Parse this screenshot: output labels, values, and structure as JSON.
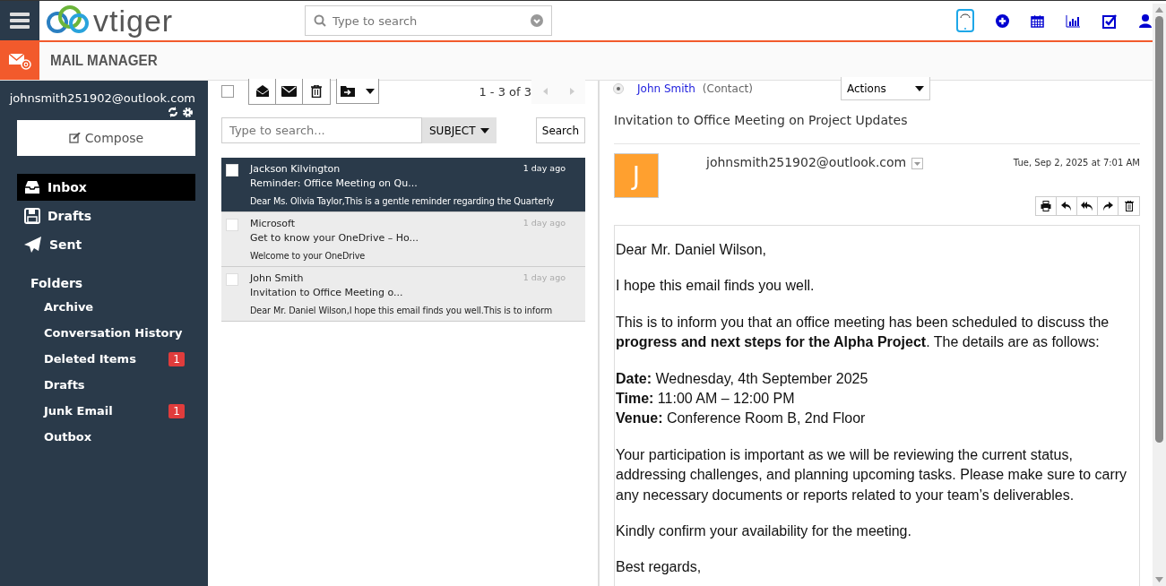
{
  "header": {
    "logo": "vtiger",
    "search": {
      "placeholder": "Type to search"
    }
  },
  "module_bar": {
    "title": "MAIL MANAGER"
  },
  "sidebar": {
    "account": "johnsmith251902@outlook.com",
    "compose": "Compose",
    "mailboxes": [
      {
        "kind": "inbox",
        "label": "Inbox",
        "selected": true
      },
      {
        "kind": "drafts",
        "label": "Drafts",
        "selected": false
      },
      {
        "kind": "sent",
        "label": "Sent",
        "selected": false
      }
    ],
    "folders_heading": "Folders",
    "folders": [
      {
        "label": "Archive"
      },
      {
        "label": "Conversation History"
      },
      {
        "label": "Deleted Items",
        "badge": "1"
      },
      {
        "label": "Drafts"
      },
      {
        "label": "Junk Email",
        "badge": "1"
      },
      {
        "label": "Outbox"
      }
    ]
  },
  "list": {
    "select_all": {
      "checked": false
    },
    "pagination": "1 - 3 of 3",
    "search": {
      "placeholder": "Type to search...",
      "field": "SUBJECT",
      "button": "Search"
    },
    "messages": [
      {
        "sender": "Jackson Kilvington",
        "time": "1 day ago",
        "subject": "Reminder: Office Meeting on Qu...",
        "preview": "Dear Ms. Olivia Taylor,This is a gentle reminder regarding the Quarterly",
        "selected": true,
        "checked": false
      },
      {
        "sender": "Microsoft",
        "time": "1 day ago",
        "subject": "Get to know your OneDrive – Ho...",
        "preview": "Welcome to your OneDrive",
        "selected": false,
        "checked": false
      },
      {
        "sender": "John Smith",
        "time": "1 day ago",
        "subject": "Invitation to Office Meeting o...",
        "preview": "Dear Mr. Daniel Wilson,I hope this email finds you well.This is to inform",
        "selected": false,
        "checked": false
      }
    ]
  },
  "reader": {
    "contact": {
      "name": "John Smith",
      "type": "(Contact)",
      "selected": true
    },
    "actions": "Actions",
    "subject": "Invitation to Office Meeting on Project Updates",
    "avatar_letter": "J",
    "from": "johnsmith251902@outlook.com",
    "date": "Tue, Sep 2, 2025 at 7:01 AM",
    "body": [
      "Dear Mr. Daniel Wilson,",
      "I hope this email finds you well.",
      "This is to inform you that an office meeting has been scheduled to discuss the **progress and next steps for the Alpha Project**. The details are as follows:",
      [
        "**Date:** Wednesday, 4th September 2025",
        "**Time:** 11:00 AM – 12:00 PM",
        "**Venue:** Conference Room B, 2nd Floor"
      ],
      "Your participation is important as we will be reviewing the current status, addressing challenges, and planning upcoming tasks. Please make sure to carry any necessary documents or reports related to your team’s deliverables.",
      "Kindly confirm your availability for the meeting.",
      "Best regards,"
    ]
  }
}
